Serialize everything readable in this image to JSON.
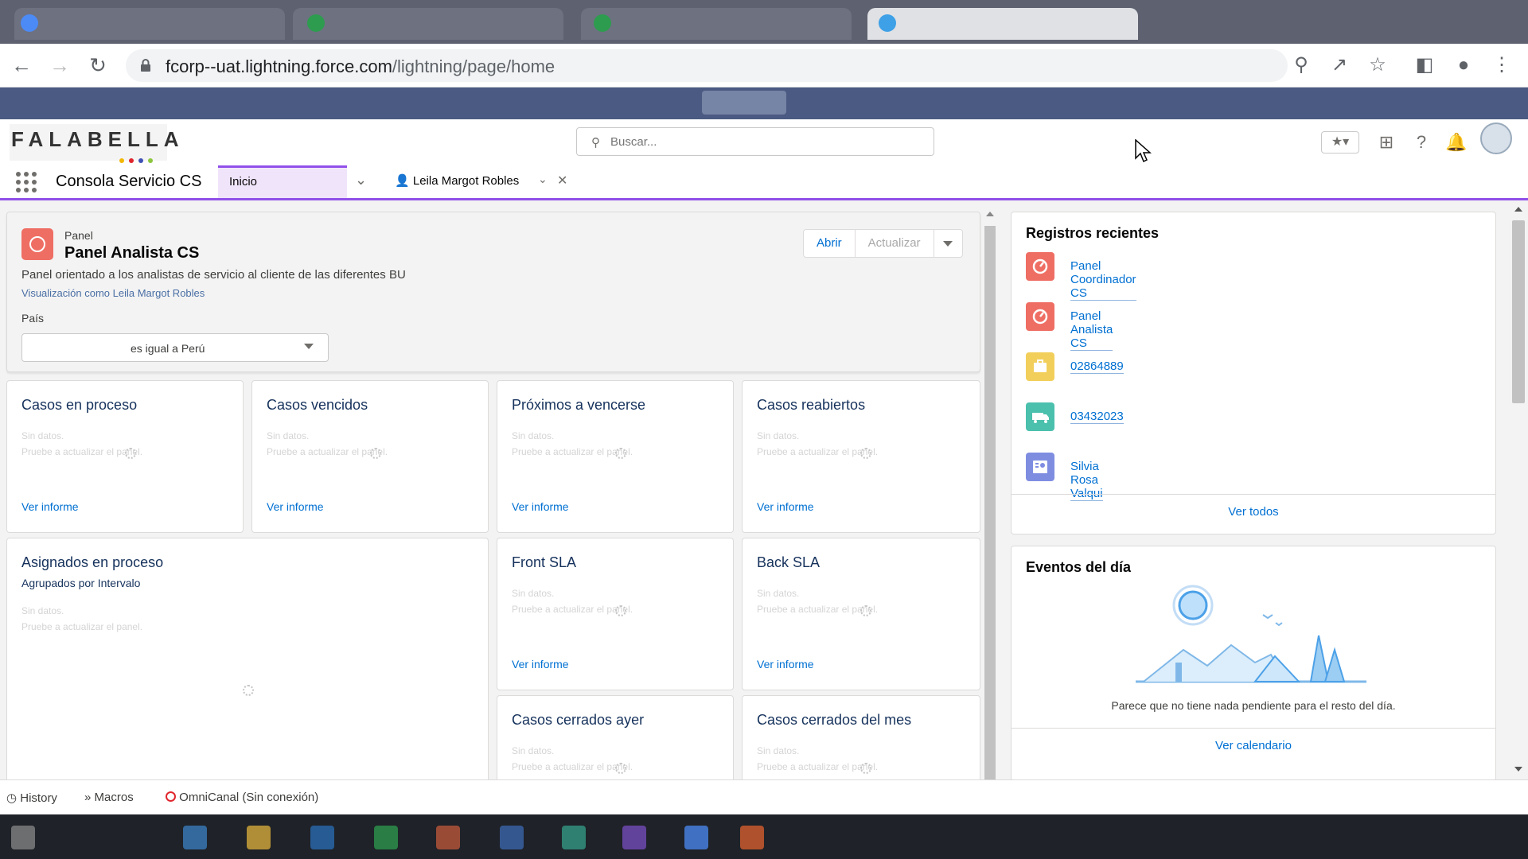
{
  "browser": {
    "url_host": "fcorp--uat.lightning.force.com",
    "url_path": "/lightning/page/home"
  },
  "header": {
    "logo_text": "FALABELLA",
    "search_placeholder": "Buscar..."
  },
  "app_nav": {
    "app_name": "Consola Servicio CS",
    "active_tab": "Inicio",
    "workspace_tab": "Leila Margot Robles"
  },
  "panel": {
    "type_label": "Panel",
    "title": "Panel Analista CS",
    "description": "Panel orientado a los analistas de servicio al cliente de las diferentes BU",
    "viewing_as": "Visualización como Leila Margot Robles",
    "filter_label": "País",
    "filter_value": "es igual a Perú",
    "buttons": {
      "open": "Abrir",
      "refresh": "Actualizar"
    }
  },
  "widgets": [
    {
      "title": "Casos en proceso",
      "nodata": "Sin datos.",
      "hint": "Pruebe a actualizar el panel.",
      "link": "Ver informe"
    },
    {
      "title": "Casos vencidos",
      "nodata": "Sin datos.",
      "hint": "Pruebe a actualizar el panel.",
      "link": "Ver informe"
    },
    {
      "title": "Próximos a vencerse",
      "nodata": "Sin datos.",
      "hint": "Pruebe a actualizar el panel.",
      "link": "Ver informe"
    },
    {
      "title": "Casos reabiertos",
      "nodata": "Sin datos.",
      "hint": "Pruebe a actualizar el panel.",
      "link": "Ver informe"
    },
    {
      "title": "Asignados en proceso",
      "subtitle": "Agrupados por Intervalo",
      "nodata": "Sin datos.",
      "hint": "Pruebe a actualizar el panel."
    },
    {
      "title": "Front SLA",
      "nodata": "Sin datos.",
      "hint": "Pruebe a actualizar el panel.",
      "link": "Ver informe"
    },
    {
      "title": "Back SLA",
      "nodata": "Sin datos.",
      "hint": "Pruebe a actualizar el panel.",
      "link": "Ver informe"
    },
    {
      "title": "Casos cerrados ayer",
      "nodata": "Sin datos.",
      "hint": "Pruebe a actualizar el panel."
    },
    {
      "title": "Casos cerrados del mes",
      "nodata": "Sin datos.",
      "hint": "Pruebe a actualizar el panel."
    }
  ],
  "recent": {
    "title": "Registros recientes",
    "items": [
      {
        "label": "Panel Coordinador CS",
        "icon": "dashboard-icon",
        "color": "#ef6e64"
      },
      {
        "label": "Panel Analista CS",
        "icon": "dashboard-icon",
        "color": "#ef6e64"
      },
      {
        "label": "02864889",
        "icon": "case-icon",
        "color": "#f2cf5b"
      },
      {
        "label": "03432023",
        "icon": "shipment-icon",
        "color": "#4bc0ad"
      },
      {
        "label": "Silvia Rosa Valqui",
        "icon": "contact-icon",
        "color": "#7f8de1"
      }
    ],
    "footer": "Ver todos"
  },
  "events": {
    "title": "Eventos del día",
    "empty_text": "Parece que no tiene nada pendiente para el resto del día.",
    "footer": "Ver calendario"
  },
  "utility_bar": {
    "history": "History",
    "macros": "Macros",
    "omni": "OmniCanal (Sin conexión)"
  },
  "colors": {
    "accent": "#9050e9",
    "link": "#0070d2",
    "banner": "#4a5a82"
  }
}
